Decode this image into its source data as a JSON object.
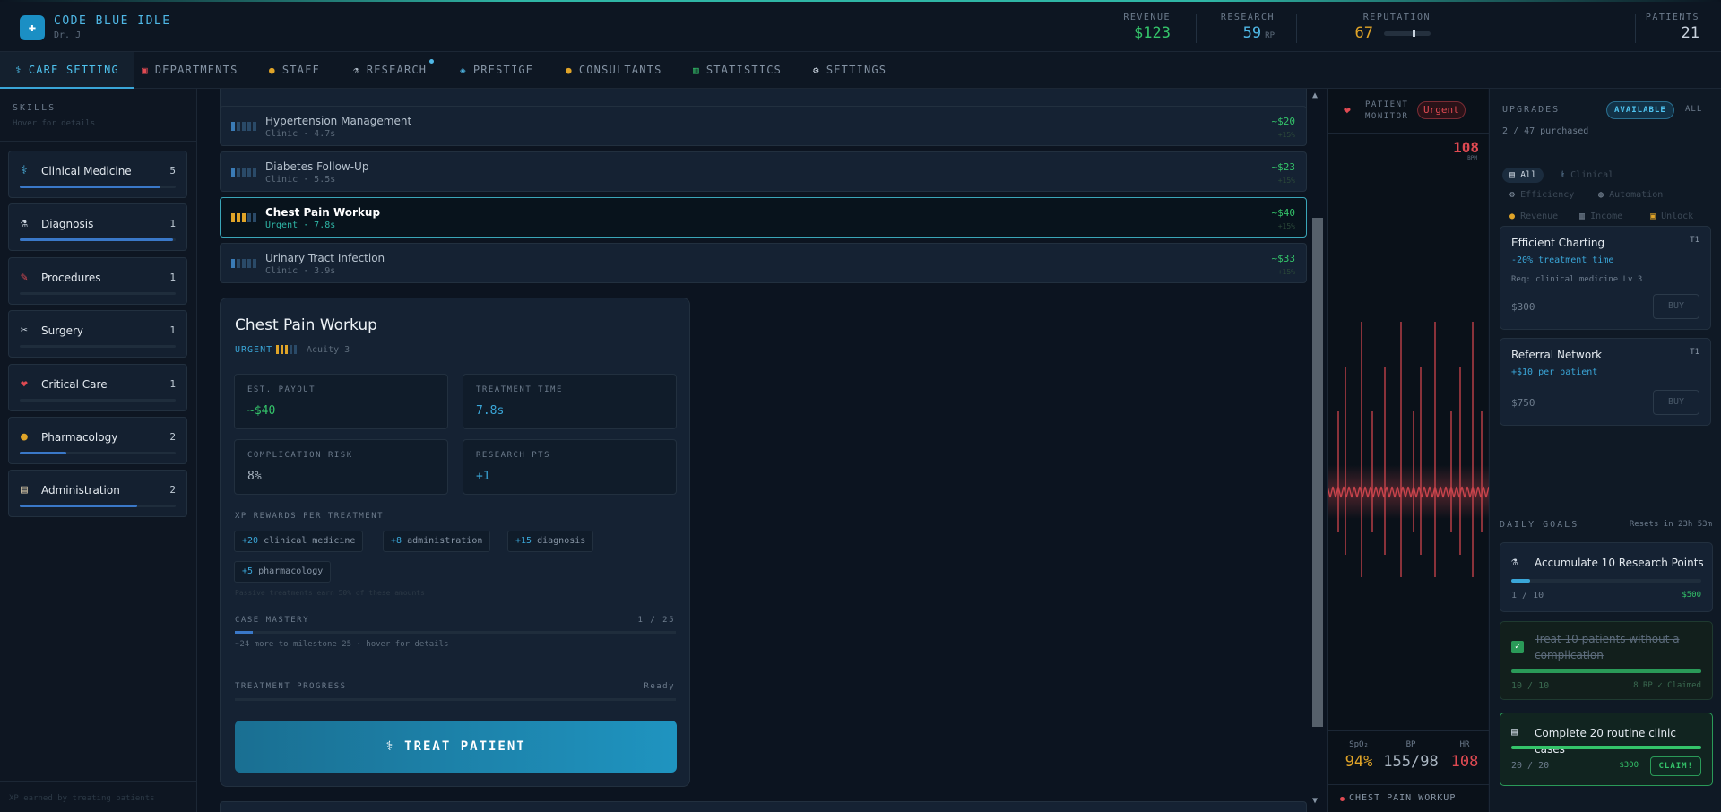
{
  "app": {
    "title": "CODE BLUE IDLE",
    "subtitle": "Dr. J"
  },
  "stats": {
    "revenue": {
      "label": "REVENUE",
      "value": "$123",
      "color": "#34c46a"
    },
    "research": {
      "label": "RESEARCH",
      "value": "59",
      "unit": "RP",
      "color": "#4fb8e6"
    },
    "reputation": {
      "label": "REPUTATION",
      "value": "67",
      "color": "#e0a428",
      "level": 0.62
    },
    "patients": {
      "label": "PATIENTS",
      "value": "21",
      "color": "#c9d3de"
    }
  },
  "tabs": [
    {
      "label": "CARE SETTING",
      "icon": "stethoscope-icon"
    },
    {
      "label": "DEPARTMENTS",
      "icon": "hospital-icon"
    },
    {
      "label": "STAFF",
      "icon": "staff-icon"
    },
    {
      "label": "RESEARCH",
      "icon": "microscope-icon"
    },
    {
      "label": "PRESTIGE",
      "icon": "prestige-icon"
    },
    {
      "label": "CONSULTANTS",
      "icon": "consultant-icon"
    },
    {
      "label": "STATISTICS",
      "icon": "chart-icon"
    },
    {
      "label": "SETTINGS",
      "icon": "gear-icon"
    }
  ],
  "sidebar": {
    "title": "SKILLS",
    "subtitle": "Hover for details",
    "footer": "XP earned by treating patients",
    "skills": [
      {
        "name": "Clinical Medicine",
        "level": "5",
        "progress": 0.9,
        "icon": "stethoscope-icon"
      },
      {
        "name": "Diagnosis",
        "level": "1",
        "progress": 0.98,
        "icon": "microscope-icon"
      },
      {
        "name": "Procedures",
        "level": "1",
        "progress": 0.0,
        "icon": "syringe-icon"
      },
      {
        "name": "Surgery",
        "level": "1",
        "progress": 0.0,
        "icon": "scalpel-icon"
      },
      {
        "name": "Critical Care",
        "level": "1",
        "progress": 0.0,
        "icon": "heart-icon"
      },
      {
        "name": "Pharmacology",
        "level": "2",
        "progress": 0.3,
        "icon": "pill-icon"
      },
      {
        "name": "Administration",
        "level": "2",
        "progress": 0.75,
        "icon": "clipboard-icon"
      }
    ]
  },
  "cases": [
    {
      "name": "Hypertension Management",
      "meta": "Clinic · 4.7s",
      "pay": "~$20",
      "xp": "+15%",
      "acuity": 1,
      "selected": false
    },
    {
      "name": "Diabetes Follow-Up",
      "meta": "Clinic · 5.5s",
      "pay": "~$23",
      "xp": "+15%",
      "acuity": 1,
      "selected": false
    },
    {
      "name": "Chest Pain Workup",
      "meta": "Urgent · 7.8s",
      "pay": "~$40",
      "xp": "+15%",
      "acuity": 3,
      "selected": true
    },
    {
      "name": "Urinary Tract Infection",
      "meta": "Clinic · 3.9s",
      "pay": "~$33",
      "xp": "+15%",
      "acuity": 1,
      "selected": false
    }
  ],
  "detail": {
    "title": "Chest Pain Workup",
    "urgency": "URGENT",
    "acuity_label": "Acuity 3",
    "payout_label": "EST. PAYOUT",
    "payout": "~$40",
    "time_label": "TREATMENT TIME",
    "time": "7.8s",
    "risk_label": "COMPLICATION RISK",
    "risk": "8%",
    "research_label": "RESEARCH PTS",
    "research": "+1",
    "xp_title": "XP REWARDS PER TREATMENT",
    "xp": [
      {
        "amount": "+20",
        "skill": "clinical medicine"
      },
      {
        "amount": "+8",
        "skill": "administration"
      },
      {
        "amount": "+15",
        "skill": "diagnosis"
      },
      {
        "amount": "+5",
        "skill": "pharmacology"
      }
    ],
    "passive_hint": "Passive treatments earn 50% of these amounts",
    "mastery_label": "CASE MASTERY",
    "mastery_value": "1 / 25",
    "mastery_progress": 0.04,
    "mastery_hint": "~24 more to milestone 25 · hover for details",
    "progress_label": "TREATMENT PROGRESS",
    "progress_status": "Ready",
    "treat_button": "⚕ TREAT PATIENT"
  },
  "monitor": {
    "label": "PATIENT MONITOR",
    "status": "Urgent",
    "hr_big": "108",
    "hr_unit": "BPM",
    "spo2_label": "SpO₂",
    "spo2": "94%",
    "bp_label": "BP",
    "bp": "155/98",
    "hr_label": "HR",
    "hr": "108",
    "case": "CHEST PAIN WORKUP",
    "colors": {
      "spo2": "#e0a428",
      "bp": "#a9b5c1",
      "hr": "#e04a52"
    }
  },
  "upgrades": {
    "title": "UPGRADES",
    "filter_available": "AVAILABLE",
    "filter_all": "ALL",
    "count": "2 / 47 purchased",
    "categories": [
      "All",
      "Clinical",
      "Efficiency",
      "Automation",
      "Revenue",
      "Income",
      "Unlock"
    ],
    "items": [
      {
        "name": "Efficient Charting",
        "tier": "T1",
        "effect": "-20% treatment time",
        "req": "Req: clinical medicine Lv 3",
        "price": "$300",
        "buy": "BUY"
      },
      {
        "name": "Referral Network",
        "tier": "T1",
        "effect": "+$10 per patient",
        "req": "",
        "price": "$750",
        "buy": "BUY"
      }
    ]
  },
  "goals": {
    "title": "DAILY GOALS",
    "reset": "Resets in 23h 53m",
    "items": [
      {
        "name": "Accumulate 10 Research Points",
        "progress_text": "1 / 10",
        "reward": "$500",
        "progress": 0.1,
        "state": "active"
      },
      {
        "name": "Treat 10 patients without a complication",
        "progress_text": "10 / 10",
        "reward": "8 RP ✓ Claimed",
        "progress": 1.0,
        "state": "done"
      },
      {
        "name": "Complete 20 routine clinic cases",
        "progress_text": "20 / 20",
        "reward": "$300",
        "progress": 1.0,
        "state": "claim",
        "claim": "CLAIM!"
      }
    ]
  }
}
